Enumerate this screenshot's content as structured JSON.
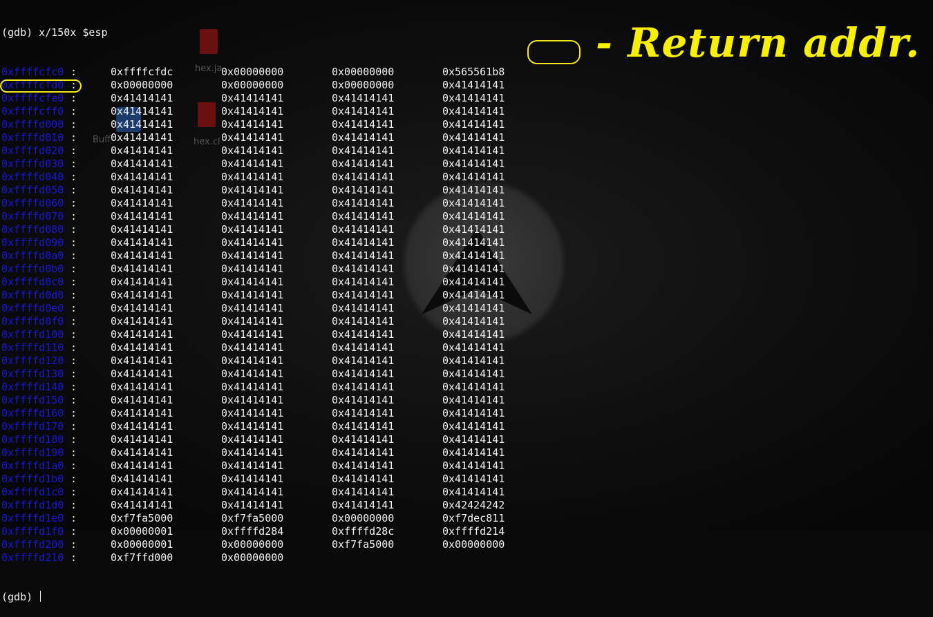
{
  "terminal": {
    "command_line": "(gdb) x/150x $esp",
    "prompt": "(gdb) ",
    "rows": [
      {
        "addr": "0xffffcfc0",
        "values": [
          "0xffffcfdc",
          "0x00000000",
          "0x00000000",
          "0x565561b8"
        ]
      },
      {
        "addr": "0xffffcfd0",
        "values": [
          "0x00000000",
          "0x00000000",
          "0x00000000",
          "0x41414141"
        ]
      },
      {
        "addr": "0xffffcfe0",
        "values": [
          "0x41414141",
          "0x41414141",
          "0x41414141",
          "0x41414141"
        ]
      },
      {
        "addr": "0xffffcff0",
        "values": [
          "0x41414141",
          "0x41414141",
          "0x41414141",
          "0x41414141"
        ]
      },
      {
        "addr": "0xffffd000",
        "values": [
          "0x41414141",
          "0x41414141",
          "0x41414141",
          "0x41414141"
        ]
      },
      {
        "addr": "0xffffd010",
        "values": [
          "0x41414141",
          "0x41414141",
          "0x41414141",
          "0x41414141"
        ]
      },
      {
        "addr": "0xffffd020",
        "values": [
          "0x41414141",
          "0x41414141",
          "0x41414141",
          "0x41414141"
        ]
      },
      {
        "addr": "0xffffd030",
        "values": [
          "0x41414141",
          "0x41414141",
          "0x41414141",
          "0x41414141"
        ]
      },
      {
        "addr": "0xffffd040",
        "values": [
          "0x41414141",
          "0x41414141",
          "0x41414141",
          "0x41414141"
        ]
      },
      {
        "addr": "0xffffd050",
        "values": [
          "0x41414141",
          "0x41414141",
          "0x41414141",
          "0x41414141"
        ]
      },
      {
        "addr": "0xffffd060",
        "values": [
          "0x41414141",
          "0x41414141",
          "0x41414141",
          "0x41414141"
        ]
      },
      {
        "addr": "0xffffd070",
        "values": [
          "0x41414141",
          "0x41414141",
          "0x41414141",
          "0x41414141"
        ]
      },
      {
        "addr": "0xffffd080",
        "values": [
          "0x41414141",
          "0x41414141",
          "0x41414141",
          "0x41414141"
        ]
      },
      {
        "addr": "0xffffd090",
        "values": [
          "0x41414141",
          "0x41414141",
          "0x41414141",
          "0x41414141"
        ]
      },
      {
        "addr": "0xffffd0a0",
        "values": [
          "0x41414141",
          "0x41414141",
          "0x41414141",
          "0x41414141"
        ]
      },
      {
        "addr": "0xffffd0b0",
        "values": [
          "0x41414141",
          "0x41414141",
          "0x41414141",
          "0x41414141"
        ]
      },
      {
        "addr": "0xffffd0c0",
        "values": [
          "0x41414141",
          "0x41414141",
          "0x41414141",
          "0x41414141"
        ]
      },
      {
        "addr": "0xffffd0d0",
        "values": [
          "0x41414141",
          "0x41414141",
          "0x41414141",
          "0x41414141"
        ]
      },
      {
        "addr": "0xffffd0e0",
        "values": [
          "0x41414141",
          "0x41414141",
          "0x41414141",
          "0x41414141"
        ]
      },
      {
        "addr": "0xffffd0f0",
        "values": [
          "0x41414141",
          "0x41414141",
          "0x41414141",
          "0x41414141"
        ]
      },
      {
        "addr": "0xffffd100",
        "values": [
          "0x41414141",
          "0x41414141",
          "0x41414141",
          "0x41414141"
        ]
      },
      {
        "addr": "0xffffd110",
        "values": [
          "0x41414141",
          "0x41414141",
          "0x41414141",
          "0x41414141"
        ]
      },
      {
        "addr": "0xffffd120",
        "values": [
          "0x41414141",
          "0x41414141",
          "0x41414141",
          "0x41414141"
        ]
      },
      {
        "addr": "0xffffd130",
        "values": [
          "0x41414141",
          "0x41414141",
          "0x41414141",
          "0x41414141"
        ]
      },
      {
        "addr": "0xffffd140",
        "values": [
          "0x41414141",
          "0x41414141",
          "0x41414141",
          "0x41414141"
        ]
      },
      {
        "addr": "0xffffd150",
        "values": [
          "0x41414141",
          "0x41414141",
          "0x41414141",
          "0x41414141"
        ]
      },
      {
        "addr": "0xffffd160",
        "values": [
          "0x41414141",
          "0x41414141",
          "0x41414141",
          "0x41414141"
        ]
      },
      {
        "addr": "0xffffd170",
        "values": [
          "0x41414141",
          "0x41414141",
          "0x41414141",
          "0x41414141"
        ]
      },
      {
        "addr": "0xffffd180",
        "values": [
          "0x41414141",
          "0x41414141",
          "0x41414141",
          "0x41414141"
        ]
      },
      {
        "addr": "0xffffd190",
        "values": [
          "0x41414141",
          "0x41414141",
          "0x41414141",
          "0x41414141"
        ]
      },
      {
        "addr": "0xffffd1a0",
        "values": [
          "0x41414141",
          "0x41414141",
          "0x41414141",
          "0x41414141"
        ]
      },
      {
        "addr": "0xffffd1b0",
        "values": [
          "0x41414141",
          "0x41414141",
          "0x41414141",
          "0x41414141"
        ]
      },
      {
        "addr": "0xffffd1c0",
        "values": [
          "0x41414141",
          "0x41414141",
          "0x41414141",
          "0x41414141"
        ]
      },
      {
        "addr": "0xffffd1d0",
        "values": [
          "0x41414141",
          "0x41414141",
          "0x41414141",
          "0x42424242"
        ]
      },
      {
        "addr": "0xffffd1e0",
        "values": [
          "0xf7fa5000",
          "0xf7fa5000",
          "0x00000000",
          "0xf7dec811"
        ]
      },
      {
        "addr": "0xffffd1f0",
        "values": [
          "0x00000001",
          "0xffffd284",
          "0xffffd28c",
          "0xffffd214"
        ]
      },
      {
        "addr": "0xffffd200",
        "values": [
          "0x00000001",
          "0x00000000",
          "0xf7fa5000",
          "0x00000000"
        ]
      },
      {
        "addr": "0xffffd210",
        "values": [
          "0xf7ffd000",
          "0x00000000"
        ]
      }
    ]
  },
  "annotation": {
    "legend_text": "- Return addr.",
    "color": "#f3e81b"
  },
  "desktop_icons": [
    {
      "label": "hex.ja",
      "icon": "java-file-icon"
    },
    {
      "label": "hex.cl",
      "icon": "class-file-icon"
    },
    {
      "label": "Buff",
      "icon": "folder-icon"
    }
  ],
  "colors": {
    "address": "#1a18d8",
    "text": "#f2f2f2",
    "background": "#0a0a0a"
  }
}
